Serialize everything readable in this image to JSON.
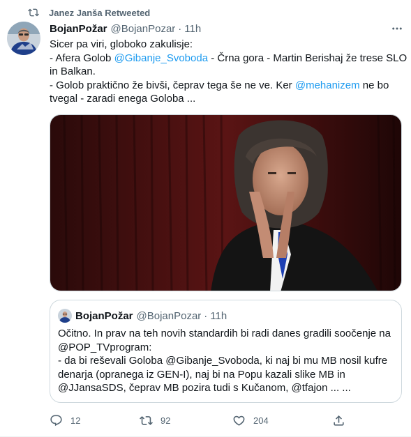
{
  "retweet_banner": {
    "text": "Janez Janša Retweeted",
    "icon": "retweet-icon"
  },
  "tweet": {
    "author_name": "BojanPožar",
    "author_handle": "@BojanPozar",
    "separator": "·",
    "time": "11h",
    "more_icon": "more-icon",
    "lines": [
      [
        {
          "t": "Sicer pa viri, globoko zakulisje:"
        }
      ],
      [
        {
          "t": "- Afera Golob "
        },
        {
          "t": "@Gibanje_Svoboda",
          "m": true
        },
        {
          "t": " - Črna gora - Martin Berishaj že trese SLO"
        }
      ],
      [
        {
          "t": "in Balkan."
        }
      ],
      [
        {
          "t": "- Golob praktično že bivši, čeprav tega še ne ve. Ker "
        },
        {
          "t": "@mehanizem",
          "m": true
        },
        {
          "t": " ne bo"
        }
      ],
      [
        {
          "t": "tvegal - zaradi enega Goloba ..."
        }
      ]
    ]
  },
  "quoted_tweet": {
    "author_name": "BojanPožar",
    "author_handle": "@BojanPozar",
    "separator": "·",
    "time": "11h",
    "lines": [
      "Očitno. In prav na teh novih standardih bi radi danes gradili soočenje na",
      "@POP_TVprogram:",
      "- da bi reševali Goloba @Gibanje_Svoboda, ki naj bi mu MB nosil kufre",
      "denarja (opranega iz GEN-I), naj bi na Popu kazali slike MB in",
      "@JJansaSDS, čeprav MB pozira tudi s Kučanom, @tfajon ... ..."
    ]
  },
  "actions": {
    "reply_count": "12",
    "retweet_count": "92",
    "like_count": "204",
    "icons": [
      "reply-icon",
      "retweet-icon",
      "like-icon",
      "share-icon"
    ]
  },
  "colors": {
    "text": "#0f1419",
    "secondary": "#536471",
    "link": "#1d9bf0",
    "border": "#cfd9de"
  }
}
